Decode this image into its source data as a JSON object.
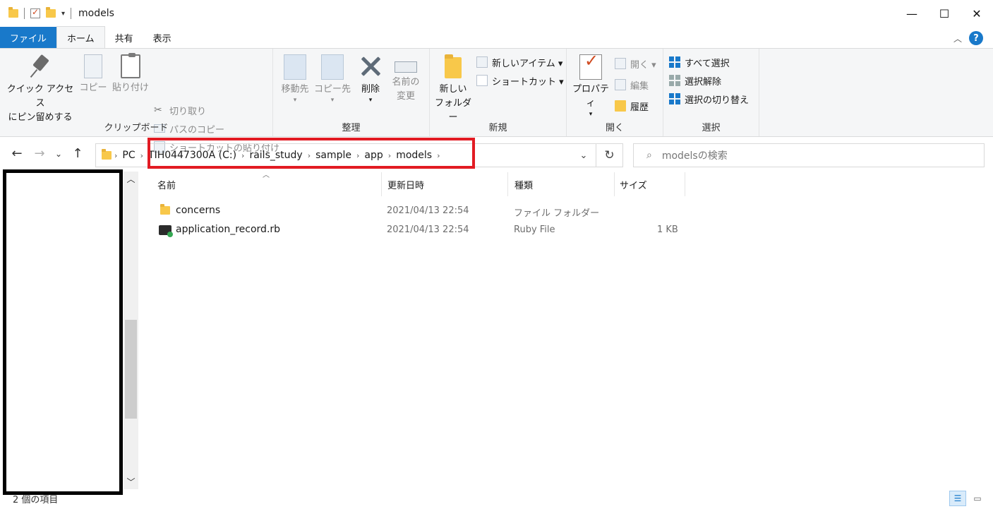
{
  "window": {
    "title": "models",
    "controls": {
      "minimize": "—",
      "maximize": "☐",
      "close": "✕"
    }
  },
  "tabs": [
    {
      "label": "ファイル"
    },
    {
      "label": "ホーム"
    },
    {
      "label": "共有"
    },
    {
      "label": "表示"
    }
  ],
  "ribbon": {
    "clipboard": {
      "group_label": "クリップボード",
      "pin_line1": "クイック アクセス",
      "pin_line2": "にピン留めする",
      "copy": "コピー",
      "paste": "貼り付け",
      "cut": "切り取り",
      "copy_path": "パスのコピー",
      "paste_shortcut": "ショートカットの貼り付け"
    },
    "organize": {
      "group_label": "整理",
      "move_to": "移動先",
      "copy_to": "コピー先",
      "delete": "削除",
      "rename_line1": "名前の",
      "rename_line2": "変更"
    },
    "new": {
      "group_label": "新規",
      "new_folder_line1": "新しい",
      "new_folder_line2": "フォルダー",
      "new_item": "新しいアイテム ▾",
      "shortcut": "ショートカット ▾"
    },
    "open": {
      "group_label": "開く",
      "properties": "プロパティ",
      "open": "開く ▾",
      "edit": "編集",
      "history": "履歴"
    },
    "select": {
      "group_label": "選択",
      "select_all": "すべて選択",
      "select_none": "選択解除",
      "invert": "選択の切り替え"
    }
  },
  "address": {
    "crumbs": [
      "PC",
      "TIH0447300A (C:)",
      "rails_study",
      "sample",
      "app",
      "models"
    ],
    "search_placeholder": "modelsの検索"
  },
  "columns": {
    "name": "名前",
    "modified": "更新日時",
    "type": "種類",
    "size": "サイズ"
  },
  "files": [
    {
      "name": "concerns",
      "modified": "2021/04/13 22:54",
      "type": "ファイル フォルダー",
      "size": "",
      "icon": "folder-icon"
    },
    {
      "name": "application_record.rb",
      "modified": "2021/04/13 22:54",
      "type": "Ruby File",
      "size": "1 KB",
      "icon": "ruby-file-icon"
    }
  ],
  "status": {
    "item_count": "2 個の項目"
  },
  "colors": {
    "accent": "#1979ca",
    "highlight_box": "#e21b23"
  }
}
